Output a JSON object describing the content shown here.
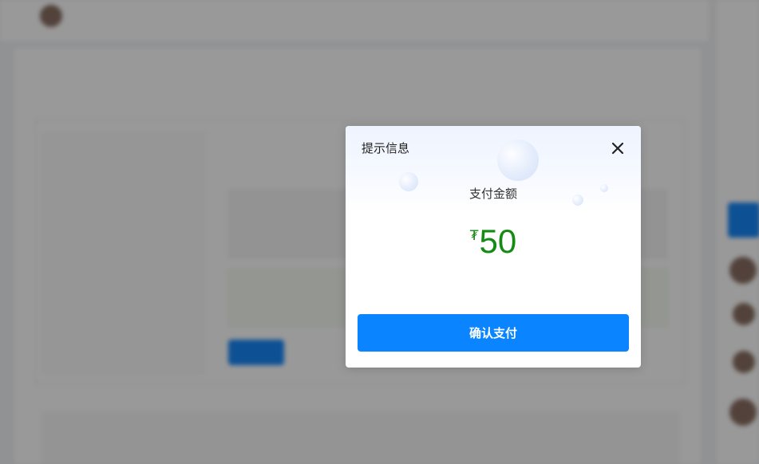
{
  "dialog": {
    "title": "提示信息",
    "amount_label": "支付金额",
    "currency_symbol": "₮",
    "amount": "50",
    "confirm_label": "确认支付",
    "close_icon": "close-icon"
  },
  "colors": {
    "confirm_button": "#0a85ff",
    "amount_text": "#158a15",
    "overlay": "rgba(0,0,0,0.40)"
  }
}
